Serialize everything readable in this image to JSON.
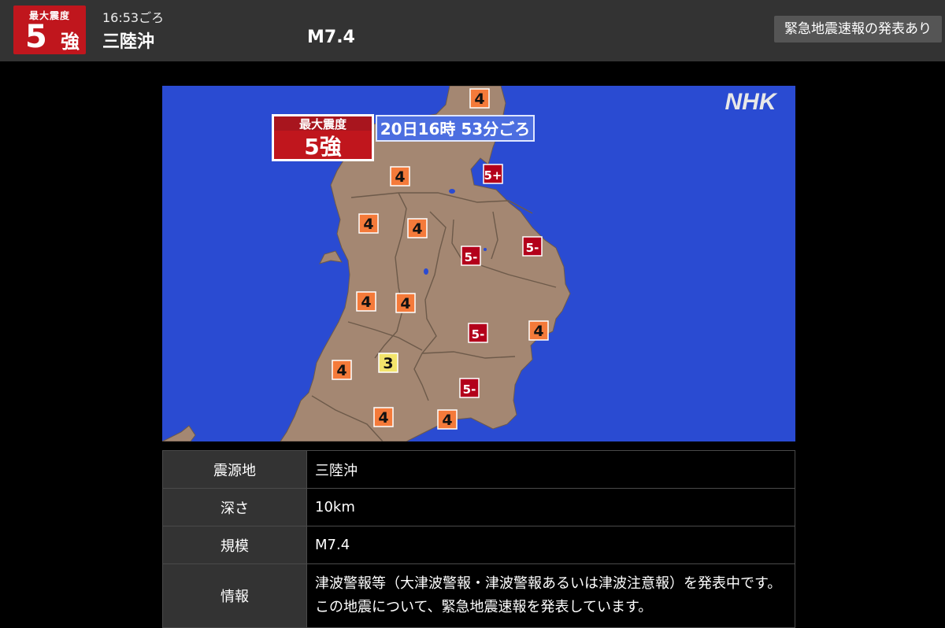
{
  "header": {
    "badge_label": "最大震度",
    "badge_number": "5",
    "badge_suffix": "強",
    "time": "16:53ごろ",
    "location": "三陸沖",
    "magnitude": "M7.4",
    "alert_button": "緊急地震速報の発表あり",
    "badge_color": "#c0161d",
    "bar_color": "#333333"
  },
  "map": {
    "logo": "NHK",
    "overlay_label": "最大震度",
    "overlay_intensity": "5強",
    "overlay_time": "20日16時 53分ごろ",
    "sea_color": "#2a4bd2",
    "land_color": "#a48772",
    "markers": [
      {
        "value": "4",
        "color": "#f47a3a"
      },
      {
        "value": "4",
        "color": "#f47a3a"
      },
      {
        "value": "5+",
        "color": "#b3001b"
      },
      {
        "value": "4",
        "color": "#f47a3a"
      },
      {
        "value": "4",
        "color": "#f47a3a"
      },
      {
        "value": "5-",
        "color": "#b3001b"
      },
      {
        "value": "5-",
        "color": "#b3001b"
      },
      {
        "value": "4",
        "color": "#f47a3a"
      },
      {
        "value": "4",
        "color": "#f47a3a"
      },
      {
        "value": "5-",
        "color": "#b3001b"
      },
      {
        "value": "4",
        "color": "#f47a3a"
      },
      {
        "value": "4",
        "color": "#f47a3a"
      },
      {
        "value": "3",
        "color": "#f2e46b"
      },
      {
        "value": "5-",
        "color": "#b3001b"
      },
      {
        "value": "4",
        "color": "#f47a3a"
      },
      {
        "value": "4",
        "color": "#f47a3a"
      }
    ]
  },
  "table": {
    "rows": [
      {
        "label": "震源地",
        "value": "三陸沖"
      },
      {
        "label": "深さ",
        "value": "10km"
      },
      {
        "label": "規模",
        "value": "M7.4"
      },
      {
        "label": "情報",
        "value": "津波警報等（大津波警報・津波警報あるいは津波注意報）を発表中です。この地震について、緊急地震速報を発表しています。"
      }
    ]
  }
}
